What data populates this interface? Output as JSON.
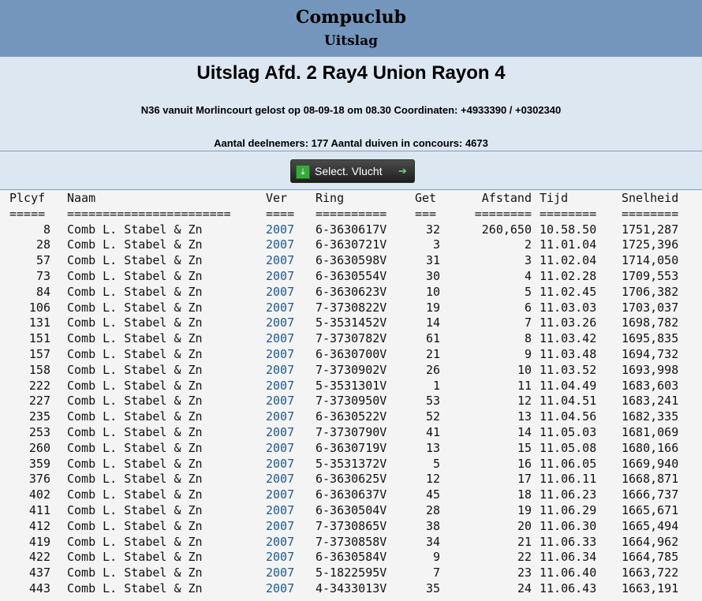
{
  "header": {
    "site_title": "Compuclub",
    "subtitle": "Uitslag"
  },
  "race": {
    "title": "Uitslag Afd. 2 Ray4 Union Rayon 4",
    "flight_info": "N36 vanuit Morlincourt gelost op 08-09-18 om 08.30 Coordinaten: +4933390 / +0302340",
    "participants": "Aantal deelnemers: 177 Aantal duiven in concours: 4673"
  },
  "select_button": {
    "label": "Select. Vlucht",
    "icon": "download-arrow-icon",
    "arrow": "arrow-right-icon"
  },
  "colors": {
    "header_bg": "#7496bd",
    "info_bg": "#dde7f1",
    "link": "#1c5a91",
    "button_bg": "#2c2c2c",
    "button_icon": "#39a83a"
  },
  "table": {
    "headers": [
      "Plcyf",
      "Naam",
      "Ver",
      "Ring",
      "Get",
      "Afstand",
      "Tijd",
      "Snelheid"
    ],
    "underlines": [
      "=====",
      "=======================",
      "====",
      "==========",
      "===",
      "========",
      "========",
      "========"
    ],
    "rows": [
      [
        "8",
        "Comb L. Stabel & Zn",
        "2007",
        "6-3630617V",
        "32",
        "260,650",
        "10.58.50",
        "1751,287"
      ],
      [
        "28",
        "Comb L. Stabel & Zn",
        "2007",
        "6-3630721V",
        "3",
        "2",
        "11.01.04",
        "1725,396"
      ],
      [
        "57",
        "Comb L. Stabel & Zn",
        "2007",
        "6-3630598V",
        "31",
        "3",
        "11.02.04",
        "1714,050"
      ],
      [
        "73",
        "Comb L. Stabel & Zn",
        "2007",
        "6-3630554V",
        "30",
        "4",
        "11.02.28",
        "1709,553"
      ],
      [
        "84",
        "Comb L. Stabel & Zn",
        "2007",
        "6-3630623V",
        "10",
        "5",
        "11.02.45",
        "1706,382"
      ],
      [
        "106",
        "Comb L. Stabel & Zn",
        "2007",
        "7-3730822V",
        "19",
        "6",
        "11.03.03",
        "1703,037"
      ],
      [
        "131",
        "Comb L. Stabel & Zn",
        "2007",
        "5-3531452V",
        "14",
        "7",
        "11.03.26",
        "1698,782"
      ],
      [
        "151",
        "Comb L. Stabel & Zn",
        "2007",
        "7-3730782V",
        "61",
        "8",
        "11.03.42",
        "1695,835"
      ],
      [
        "157",
        "Comb L. Stabel & Zn",
        "2007",
        "6-3630700V",
        "21",
        "9",
        "11.03.48",
        "1694,732"
      ],
      [
        "158",
        "Comb L. Stabel & Zn",
        "2007",
        "7-3730902V",
        "26",
        "10",
        "11.03.52",
        "1693,998"
      ],
      [
        "222",
        "Comb L. Stabel & Zn",
        "2007",
        "5-3531301V",
        "1",
        "11",
        "11.04.49",
        "1683,603"
      ],
      [
        "227",
        "Comb L. Stabel & Zn",
        "2007",
        "7-3730950V",
        "53",
        "12",
        "11.04.51",
        "1683,241"
      ],
      [
        "235",
        "Comb L. Stabel & Zn",
        "2007",
        "6-3630522V",
        "52",
        "13",
        "11.04.56",
        "1682,335"
      ],
      [
        "253",
        "Comb L. Stabel & Zn",
        "2007",
        "7-3730790V",
        "41",
        "14",
        "11.05.03",
        "1681,069"
      ],
      [
        "260",
        "Comb L. Stabel & Zn",
        "2007",
        "6-3630719V",
        "13",
        "15",
        "11.05.08",
        "1680,166"
      ],
      [
        "359",
        "Comb L. Stabel & Zn",
        "2007",
        "5-3531372V",
        "5",
        "16",
        "11.06.05",
        "1669,940"
      ],
      [
        "376",
        "Comb L. Stabel & Zn",
        "2007",
        "6-3630625V",
        "12",
        "17",
        "11.06.11",
        "1668,871"
      ],
      [
        "402",
        "Comb L. Stabel & Zn",
        "2007",
        "6-3630637V",
        "45",
        "18",
        "11.06.23",
        "1666,737"
      ],
      [
        "411",
        "Comb L. Stabel & Zn",
        "2007",
        "6-3630504V",
        "28",
        "19",
        "11.06.29",
        "1665,671"
      ],
      [
        "412",
        "Comb L. Stabel & Zn",
        "2007",
        "7-3730865V",
        "38",
        "20",
        "11.06.30",
        "1665,494"
      ],
      [
        "419",
        "Comb L. Stabel & Zn",
        "2007",
        "7-3730858V",
        "34",
        "21",
        "11.06.33",
        "1664,962"
      ],
      [
        "422",
        "Comb L. Stabel & Zn",
        "2007",
        "6-3630584V",
        "9",
        "22",
        "11.06.34",
        "1664,785"
      ],
      [
        "437",
        "Comb L. Stabel & Zn",
        "2007",
        "5-1822595V",
        "7",
        "23",
        "11.06.40",
        "1663,722"
      ],
      [
        "443",
        "Comb L. Stabel & Zn",
        "2007",
        "4-3433013V",
        "35",
        "24",
        "11.06.43",
        "1663,191"
      ]
    ]
  }
}
